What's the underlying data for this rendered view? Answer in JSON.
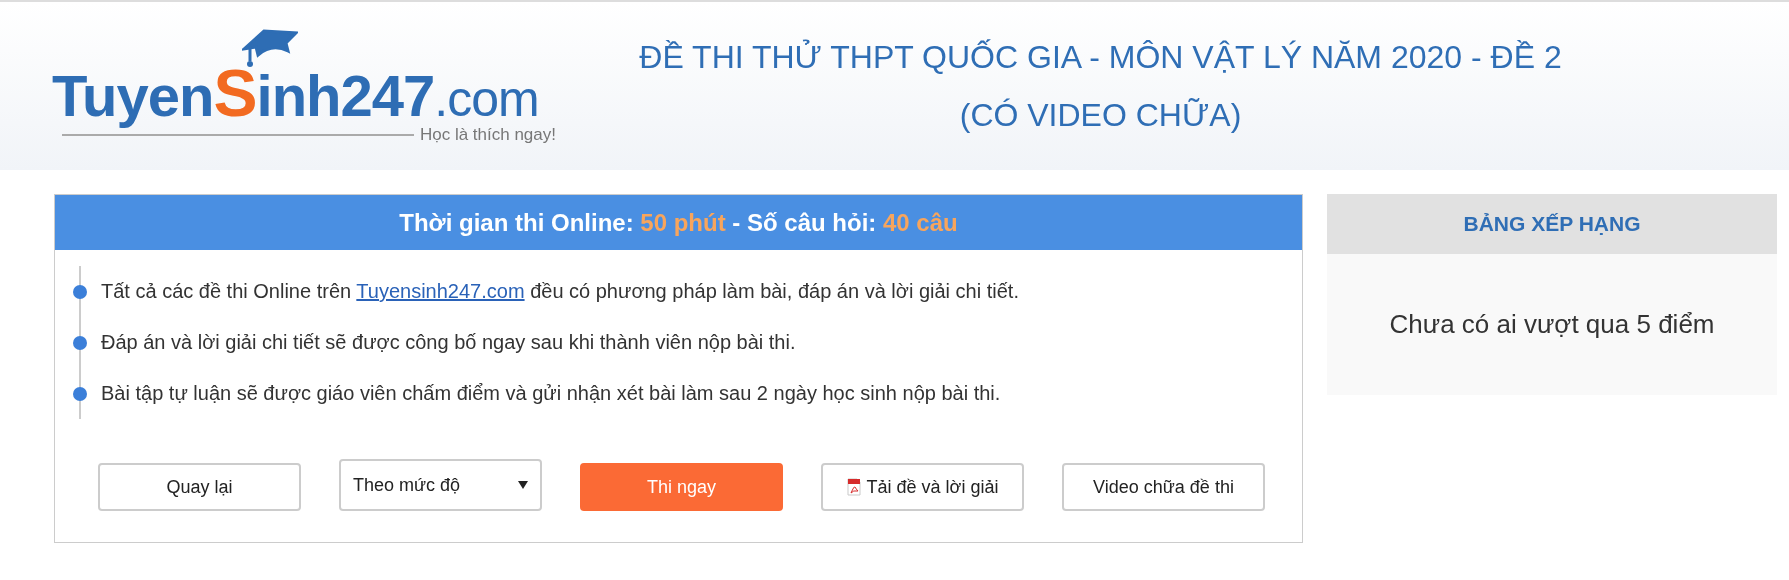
{
  "logo": {
    "parts": [
      {
        "text": "Tuyen",
        "kind": "main"
      },
      {
        "text": "S",
        "kind": "accent"
      },
      {
        "text": "inh247",
        "kind": "main"
      },
      {
        "text": ".com",
        "kind": "domain"
      }
    ],
    "tagline": "Học là thích ngay!"
  },
  "page_title": "ĐỀ THI THỬ THPT QUỐC GIA - MÔN VẬT LÝ NĂM 2020 - ĐỀ 2 (CÓ VIDEO CHỮA)",
  "exam_info": {
    "heading": [
      {
        "text": "Thời gian thi Online: ",
        "kind": "label"
      },
      {
        "text": "50 phút",
        "kind": "value"
      },
      {
        "text": " - Số câu hỏi: ",
        "kind": "label"
      },
      {
        "text": "40 câu",
        "kind": "value"
      }
    ],
    "notes": [
      {
        "before": "Tất cả các đề thi Online trên ",
        "link": "Tuyensinh247.com",
        "after": " đều có phương pháp làm bài, đáp án và lời giải chi tiết."
      },
      {
        "before": "Đáp án và lời giải chi tiết sẽ được công bố ngay sau khi thành viên nộp bài thi."
      },
      {
        "before": "Bài tập tự luận sẽ được giáo viên chấm điểm và gửi nhận xét bài làm sau 2 ngày học sinh nộp bài thi."
      }
    ],
    "actions": [
      {
        "label": "Quay lại",
        "kind": "button"
      },
      {
        "label": "Theo mức độ",
        "kind": "select"
      },
      {
        "label": "Thi ngay",
        "kind": "primary"
      },
      {
        "label": "Tải đề và lời giải",
        "kind": "pdf"
      },
      {
        "label": "Video chữa đề thi",
        "kind": "button"
      }
    ]
  },
  "ranking": {
    "title": "BẢNG XẾP HẠNG",
    "message": "Chưa có ai vượt qua 5 điểm"
  }
}
